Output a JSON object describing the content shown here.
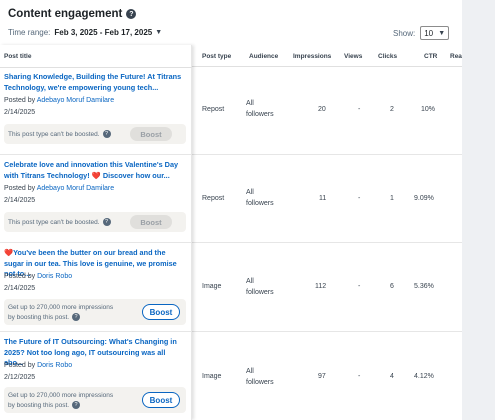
{
  "header": {
    "title": "Content engagement",
    "help_icon": "question-circle-icon"
  },
  "filters": {
    "time_range_label": "Time range:",
    "time_range_value": "Feb 3, 2025 - Feb 17, 2025",
    "show_label": "Show:",
    "show_value": "10"
  },
  "columns": {
    "post_title": "Post title",
    "post_type": "Post type",
    "audience": "Audience",
    "impressions": "Impressions",
    "views": "Views",
    "clicks": "Clicks",
    "ctr": "CTR",
    "reactions": "Rea"
  },
  "posts": [
    {
      "text": "Sharing Knowledge, Building the Future! At Titrans Technology, we're empowering young tech...",
      "posted_by_label": "Posted by",
      "author": "Adebayo Moruf Damilare",
      "date": "2/14/2025",
      "boost_message": "This post type can't be boosted.",
      "boost_label": "Boost",
      "post_type": "Repost",
      "audience_line1": "All",
      "audience_line2": "followers",
      "impressions": "20",
      "views": "-",
      "clicks": "2",
      "ctr": "10%"
    },
    {
      "text": "Celebrate love and innovation this Valentine's Day with Titrans Technology! ❤️ Discover how our...",
      "posted_by_label": "Posted by",
      "author": "Adebayo Moruf Damilare",
      "date": "2/14/2025",
      "boost_message": "This post type can't be boosted.",
      "boost_label": "Boost",
      "post_type": "Repost",
      "audience_line1": "All",
      "audience_line2": "followers",
      "impressions": "11",
      "views": "-",
      "clicks": "1",
      "ctr": "9.09%"
    },
    {
      "text": "❤️You've been the butter on our bread and the sugar in our tea. This love is genuine, we promise not to...",
      "posted_by_label": "Posted by",
      "author": "Doris Robo",
      "date": "2/14/2025",
      "boost_line1": "Get up to 270,000 more impressions",
      "boost_line2": "by boosting this post.",
      "boost_label": "Boost",
      "post_type": "Image",
      "audience_line1": "All",
      "audience_line2": "followers",
      "impressions": "112",
      "views": "-",
      "clicks": "6",
      "ctr": "5.36%"
    },
    {
      "text": "The Future of IT Outsourcing: What's Changing in 2025? Not too long ago, IT outsourcing was all abo...",
      "posted_by_label": "Posted by",
      "author": "Doris Robo",
      "date": "2/12/2025",
      "boost_line1": "Get up to 270,000 more impressions",
      "boost_line2": "by boosting this post.",
      "boost_label": "Boost",
      "post_type": "Image",
      "audience_line1": "All",
      "audience_line2": "followers",
      "impressions": "97",
      "views": "-",
      "clicks": "4",
      "ctr": "4.12%"
    }
  ]
}
